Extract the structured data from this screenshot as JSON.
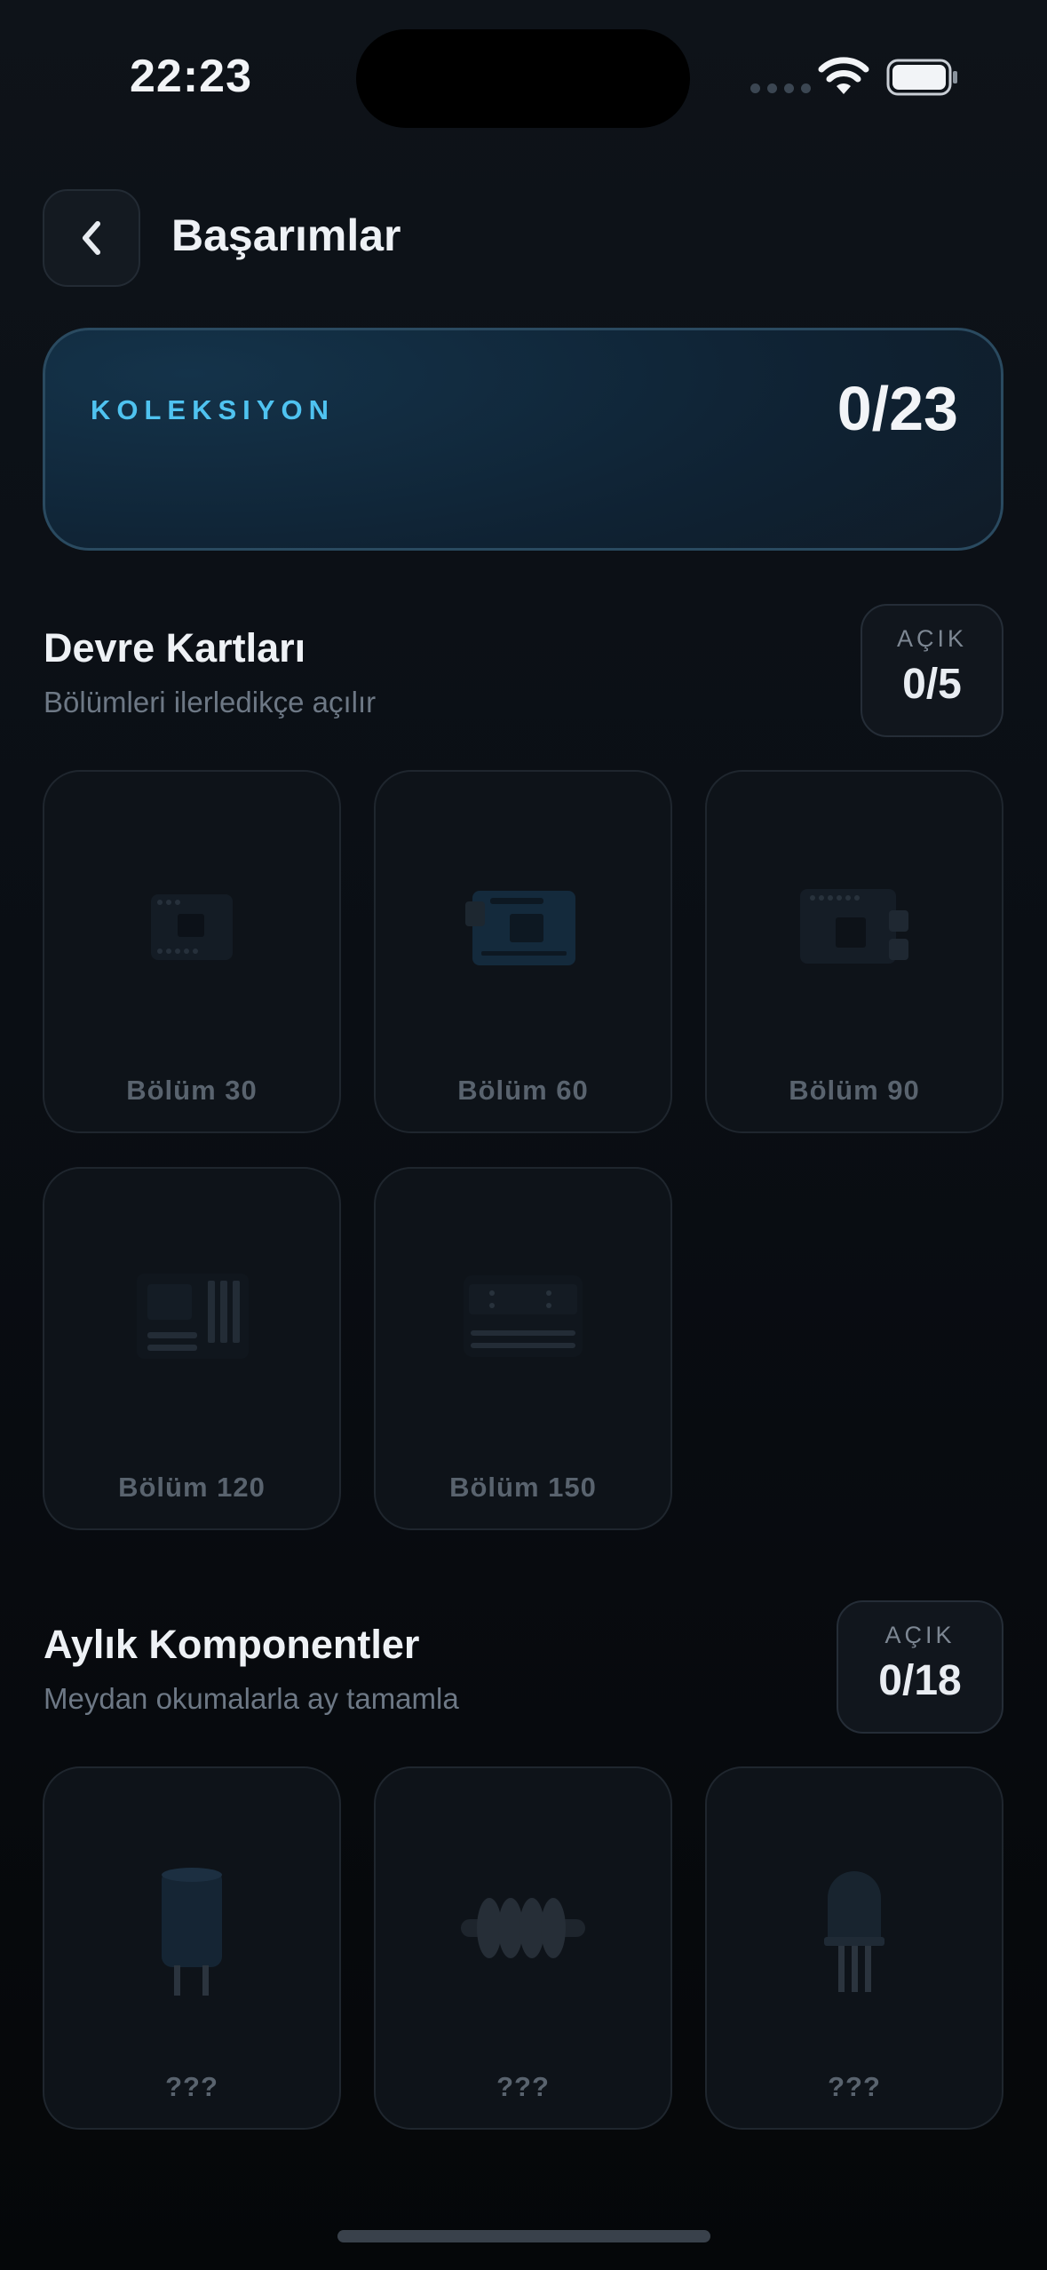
{
  "status_bar": {
    "time": "22:23"
  },
  "header": {
    "title": "Başarımlar"
  },
  "collection": {
    "label": "KOLEKSIYON",
    "count": "0/23"
  },
  "sections": [
    {
      "title": "Devre Kartları",
      "subtitle": "Bölümleri ilerledikçe açılır",
      "badge_label": "AÇIK",
      "badge_value": "0/5",
      "items": [
        {
          "label": "Bölüm 30",
          "icon": "microcontroller-board-icon"
        },
        {
          "label": "Bölüm 60",
          "icon": "pcb-board-icon"
        },
        {
          "label": "Bölüm 90",
          "icon": "dev-board-icon"
        },
        {
          "label": "Bölüm 120",
          "icon": "motherboard-icon"
        },
        {
          "label": "Bölüm 150",
          "icon": "breadboard-icon"
        }
      ]
    },
    {
      "title": "Aylık Komponentler",
      "subtitle": "Meydan okumalarla ay tamamla",
      "badge_label": "AÇIK",
      "badge_value": "0/18",
      "items": [
        {
          "label": "???",
          "icon": "capacitor-icon"
        },
        {
          "label": "???",
          "icon": "inductor-coil-icon"
        },
        {
          "label": "???",
          "icon": "led-icon"
        }
      ]
    }
  ]
}
